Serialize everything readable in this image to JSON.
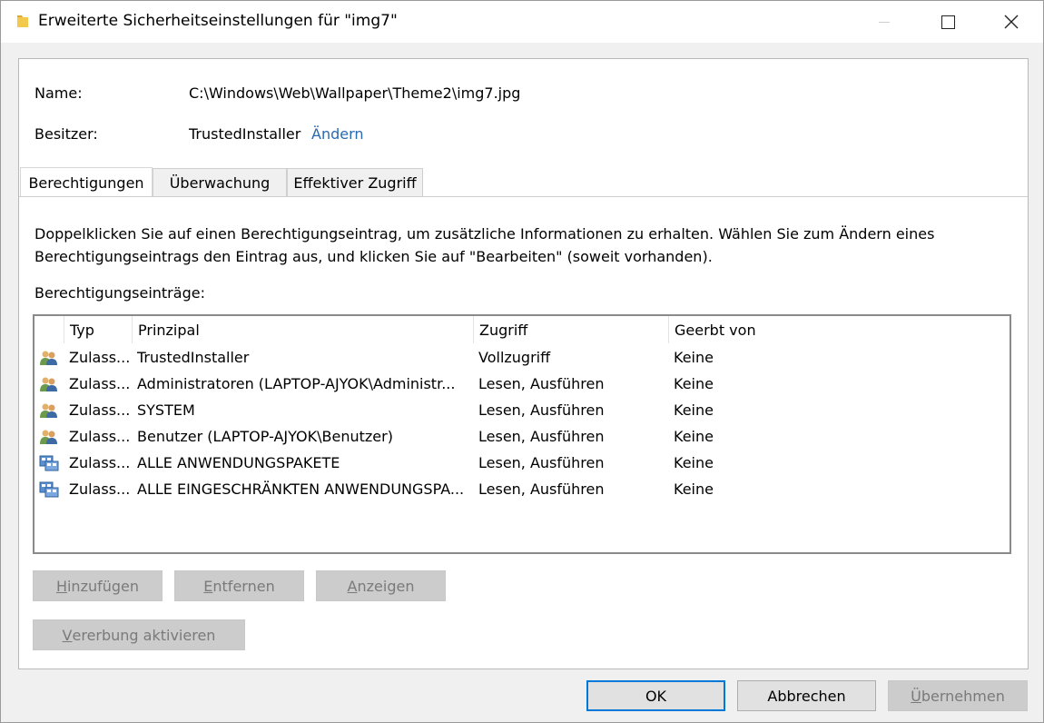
{
  "window": {
    "title": "Erweiterte Sicherheitseinstellungen für \"img7\"",
    "icon": "folder-icon"
  },
  "name_field": {
    "label": "Name:",
    "value": "C:\\Windows\\Web\\Wallpaper\\Theme2\\img7.jpg"
  },
  "owner_field": {
    "label": "Besitzer:",
    "value": "TrustedInstaller",
    "change_link": "Ändern"
  },
  "tabs": [
    {
      "label": "Berechtigungen",
      "active": true
    },
    {
      "label": "Überwachung",
      "active": false
    },
    {
      "label": "Effektiver Zugriff",
      "active": false
    }
  ],
  "description": {
    "line1": "Doppelklicken Sie auf einen Berechtigungseintrag, um zusätzliche Informationen zu erhalten. Wählen Sie zum Ändern eines",
    "line2": "Berechtigungseintrags den Eintrag aus, und klicken Sie auf \"Bearbeiten\" (soweit vorhanden)."
  },
  "entries_label": "Berechtigungseinträge:",
  "table": {
    "columns": [
      "Typ",
      "Prinzipal",
      "Zugriff",
      "Geerbt von"
    ],
    "rows": [
      {
        "icon": "user-group-icon",
        "type": "Zulass...",
        "principal": "TrustedInstaller",
        "access": "Vollzugriff",
        "inherited": "Keine"
      },
      {
        "icon": "user-group-icon",
        "type": "Zulass...",
        "principal": "Administratoren (LAPTOP-AJYOK\\Administr...",
        "access": "Lesen, Ausführen",
        "inherited": "Keine"
      },
      {
        "icon": "user-group-icon",
        "type": "Zulass...",
        "principal": "SYSTEM",
        "access": "Lesen, Ausführen",
        "inherited": "Keine"
      },
      {
        "icon": "user-group-icon",
        "type": "Zulass...",
        "principal": "Benutzer (LAPTOP-AJYOK\\Benutzer)",
        "access": "Lesen, Ausführen",
        "inherited": "Keine"
      },
      {
        "icon": "app-package-icon",
        "type": "Zulass...",
        "principal": "ALLE ANWENDUNGSPAKETE",
        "access": "Lesen, Ausführen",
        "inherited": "Keine"
      },
      {
        "icon": "app-package-icon",
        "type": "Zulass...",
        "principal": "ALLE EINGESCHRÄNKTEN ANWENDUNGSPA...",
        "access": "Lesen, Ausführen",
        "inherited": "Keine"
      }
    ]
  },
  "buttons": {
    "add": {
      "mnemonic": "H",
      "rest": "inzufügen"
    },
    "remove": {
      "mnemonic": "E",
      "rest": "ntfernen"
    },
    "view": {
      "mnemonic": "A",
      "rest": "nzeigen"
    },
    "inherit": {
      "mnemonic": "V",
      "rest": "ererbung aktivieren"
    },
    "ok": "OK",
    "cancel": "Abbrechen",
    "apply": {
      "mnemonic": "Ü",
      "rest": "bernehmen"
    }
  }
}
